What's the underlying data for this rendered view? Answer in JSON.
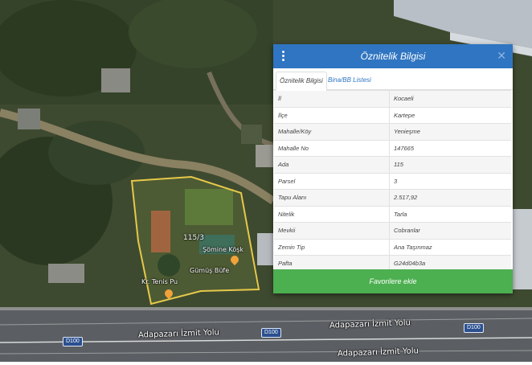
{
  "panel": {
    "title": "Öznitelik Bilgisi",
    "tabs": [
      {
        "label": "Öznitelik Bilgisi"
      },
      {
        "label": "Bina/BB Listesi"
      }
    ],
    "rows": [
      {
        "key": "İl",
        "value": "Kocaeli"
      },
      {
        "key": "İlçe",
        "value": "Kartepe"
      },
      {
        "key": "Mahalle/Köy",
        "value": "Yenieşme"
      },
      {
        "key": "Mahalle No",
        "value": "147665"
      },
      {
        "key": "Ada",
        "value": "115"
      },
      {
        "key": "Parsel",
        "value": "3"
      },
      {
        "key": "Tapu Alanı",
        "value": "2.517,92"
      },
      {
        "key": "Nitelik",
        "value": "Tarla"
      },
      {
        "key": "Mevkii",
        "value": "Cobranlar"
      },
      {
        "key": "Zemin Tip",
        "value": "Ana Taşınmaz"
      },
      {
        "key": "Pafta",
        "value": "G24d04b3a"
      }
    ],
    "favorite_button": "Favorilere ekle",
    "menu_icon": "vertical-dots-icon",
    "close_icon": "close-icon"
  },
  "map": {
    "parcel_label": "115/3",
    "poi_labels": [
      "Şömine Köşk",
      "Gümüş Büfe",
      "Kr. Tenis Pu"
    ],
    "road_labels": [
      "Adapazarı İzmit Yolu",
      "Adapazarı İzmit Yolu",
      "Adapazarı İzmit Yolu"
    ],
    "road_shields": [
      "D100",
      "D100",
      "D100"
    ],
    "colors": {
      "header": "#2f75c1",
      "button": "#4caf50",
      "parcel": "#e6c84a"
    }
  }
}
